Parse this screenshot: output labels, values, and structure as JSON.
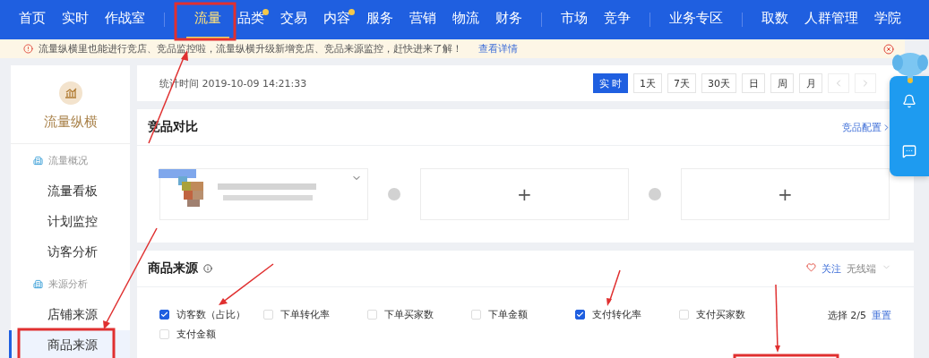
{
  "nav": {
    "groups": [
      [
        {
          "label": "首页",
          "selected": false,
          "dot": false
        },
        {
          "label": "实时",
          "selected": false,
          "dot": false
        },
        {
          "label": "作战室",
          "selected": false,
          "dot": false
        }
      ],
      [
        {
          "label": "流量",
          "selected": true,
          "dot": false
        },
        {
          "label": "品类",
          "selected": false,
          "dot": true
        },
        {
          "label": "交易",
          "selected": false,
          "dot": false
        },
        {
          "label": "内容",
          "selected": false,
          "dot": true
        },
        {
          "label": "服务",
          "selected": false,
          "dot": false
        },
        {
          "label": "营销",
          "selected": false,
          "dot": false
        },
        {
          "label": "物流",
          "selected": false,
          "dot": false
        },
        {
          "label": "财务",
          "selected": false,
          "dot": false
        }
      ],
      [
        {
          "label": "市场",
          "selected": false,
          "dot": false
        },
        {
          "label": "竞争",
          "selected": false,
          "dot": false
        }
      ],
      [
        {
          "label": "业务专区",
          "selected": false,
          "dot": false
        }
      ],
      [
        {
          "label": "取数",
          "selected": false,
          "dot": false
        },
        {
          "label": "人群管理",
          "selected": false,
          "dot": false
        },
        {
          "label": "学院",
          "selected": false,
          "dot": false
        }
      ]
    ]
  },
  "notice": {
    "text": "流量纵横里也能进行竞店、竞品监控啦，流量纵横升级新增竞店、竞品来源监控，赶快进来了解！",
    "link": "查看详情"
  },
  "sidebar": {
    "title": "流量纵横",
    "sections": [
      {
        "heading": "流量概况",
        "items": [
          {
            "label": "流量看板",
            "selected": false
          },
          {
            "label": "计划监控",
            "selected": false
          },
          {
            "label": "访客分析",
            "selected": false
          }
        ]
      },
      {
        "heading": "来源分析",
        "items": [
          {
            "label": "店铺来源",
            "selected": false
          },
          {
            "label": "商品来源",
            "selected": true
          }
        ]
      }
    ]
  },
  "stats": {
    "time": "统计时间 2019-10-09 14:21:33",
    "ranges": [
      {
        "label": "实 时",
        "selected": true
      },
      {
        "label": "1天",
        "selected": false
      },
      {
        "label": "7天",
        "selected": false
      },
      {
        "label": "30天",
        "selected": false
      },
      {
        "label": "日",
        "selected": false
      },
      {
        "label": "周",
        "selected": false
      },
      {
        "label": "月",
        "selected": false
      }
    ]
  },
  "compare": {
    "title": "竞品对比",
    "config_link": "竞品配置",
    "slots": [
      {
        "kind": "product"
      },
      {
        "kind": "empty",
        "add": "+"
      },
      {
        "kind": "empty",
        "add": "+"
      }
    ]
  },
  "source": {
    "title": "商品来源",
    "follow": "关注",
    "device": "无线端",
    "metrics": [
      {
        "label": "访客数（占比）",
        "checked": true
      },
      {
        "label": "下单转化率",
        "checked": false
      },
      {
        "label": "下单买家数",
        "checked": false
      },
      {
        "label": "下单金额",
        "checked": false
      },
      {
        "label": "支付转化率",
        "checked": true
      },
      {
        "label": "支付买家数",
        "checked": false
      },
      {
        "label": "支付金额",
        "checked": false
      }
    ],
    "selection": "选择 2/5",
    "reset": "重置"
  }
}
